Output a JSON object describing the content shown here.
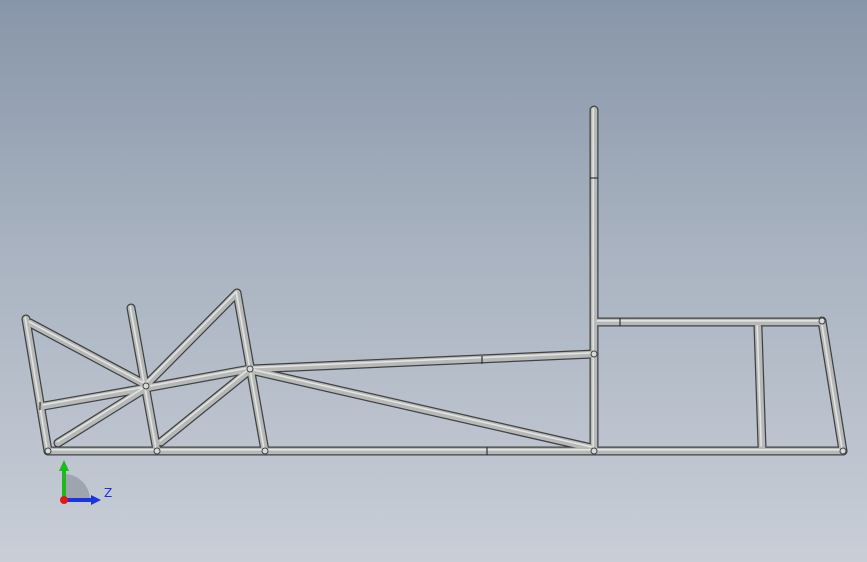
{
  "viewport": {
    "triad": {
      "z_label": "Z",
      "x_color": "#e01818",
      "y_color": "#1fb81f",
      "z_color": "#1a35e0"
    },
    "model": {
      "tube_fill": "#b7b9b7",
      "tube_edge": "#3e4242",
      "tube_highlight": "#e9ebea"
    }
  }
}
